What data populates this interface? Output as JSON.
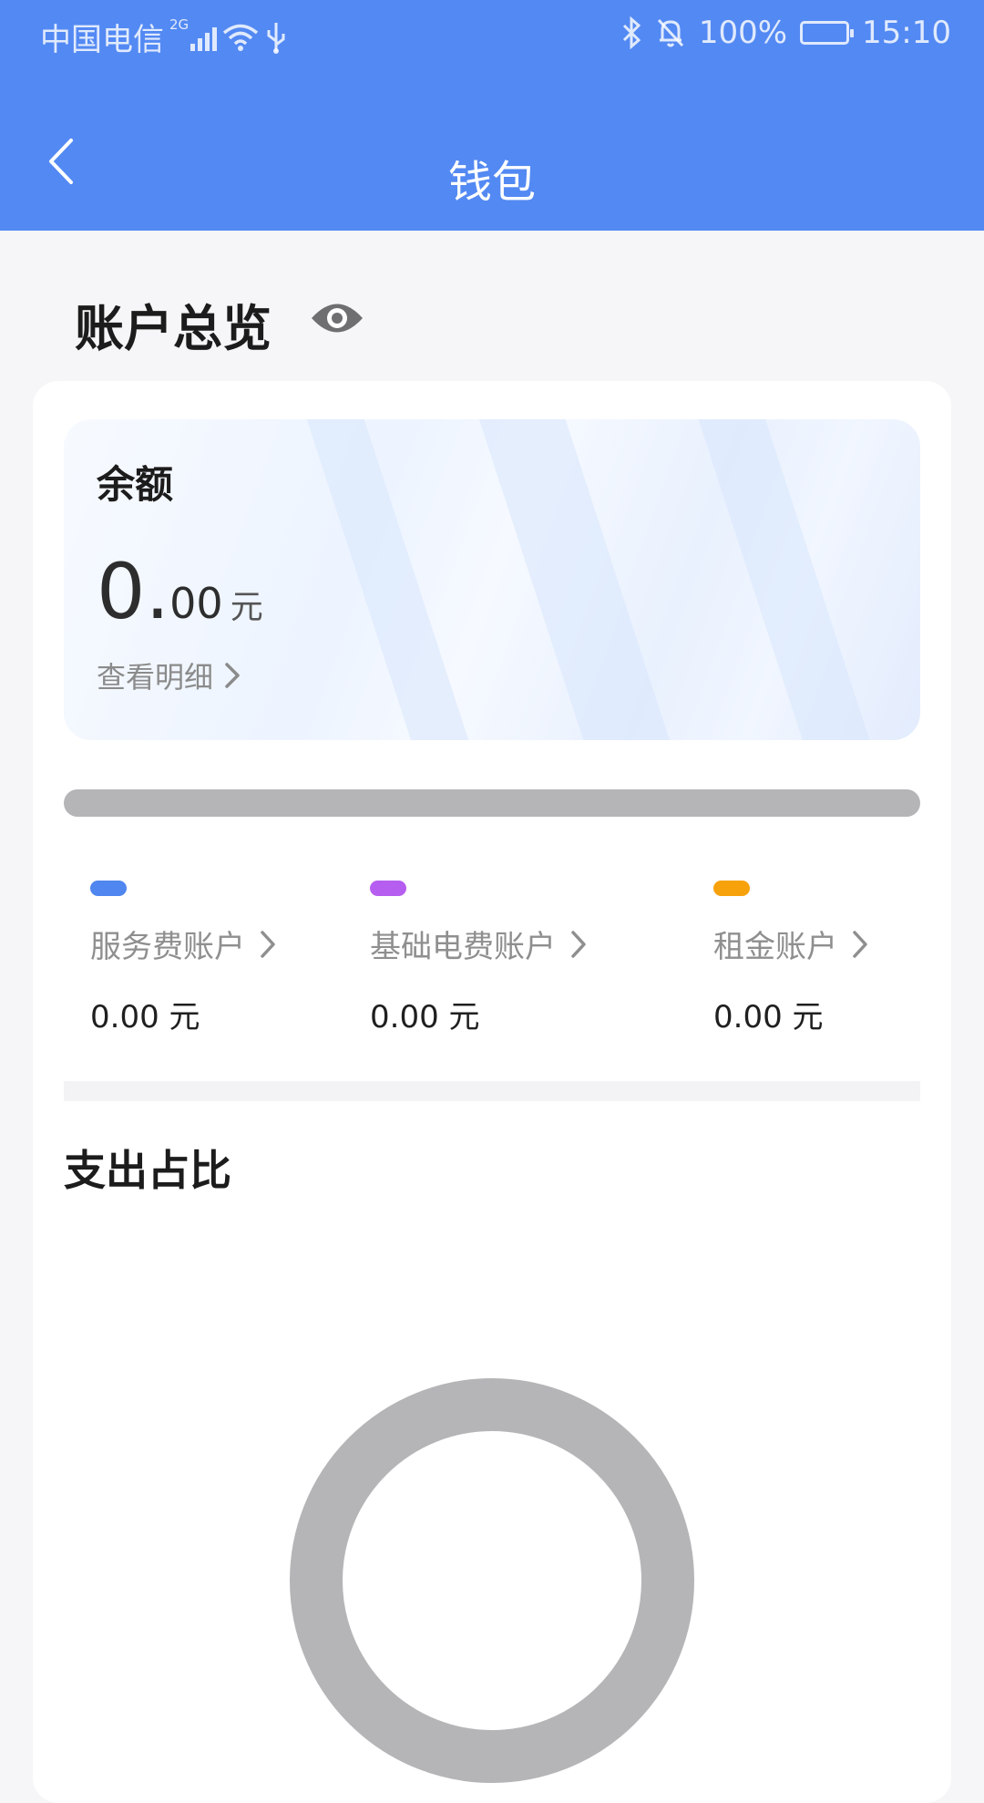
{
  "status_bar": {
    "carrier": "中国电信",
    "network": "2G",
    "battery": "100%",
    "time": "15:10"
  },
  "header": {
    "title": "钱包"
  },
  "overview": {
    "title": "账户总览"
  },
  "balance": {
    "label": "余额",
    "amount_int": "0.",
    "amount_dec": "00",
    "unit": "元",
    "detail_link": "查看明细"
  },
  "accounts": [
    {
      "name": "服务费账户",
      "value": "0.00 元",
      "color": "#4f86ef"
    },
    {
      "name": "基础电费账户",
      "value": "0.00 元",
      "color": "#b55ef0"
    },
    {
      "name": "租金账户",
      "value": "0.00 元",
      "color": "#f7a10b"
    }
  ],
  "expenditure": {
    "title": "支出占比"
  },
  "colors": {
    "brand": "#5389f3",
    "track": "#b5b5b8"
  }
}
